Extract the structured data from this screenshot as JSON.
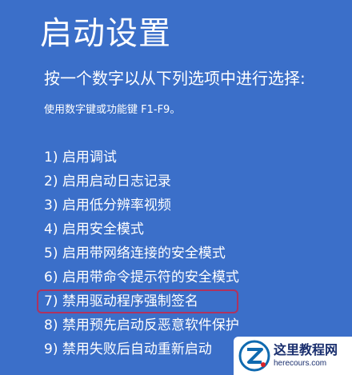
{
  "title": "启动设置",
  "subtitle": "按一个数字以从下列选项中进行选择:",
  "hint": "使用数字键或功能键 F1-F9。",
  "options": [
    {
      "number": "1)",
      "label": "启用调试"
    },
    {
      "number": "2)",
      "label": "启用启动日志记录"
    },
    {
      "number": "3)",
      "label": "启用低分辨率视频"
    },
    {
      "number": "4)",
      "label": "启用安全模式"
    },
    {
      "number": "5)",
      "label": "启用带网络连接的安全模式"
    },
    {
      "number": "6)",
      "label": "启用带命令提示符的安全模式"
    },
    {
      "number": "7)",
      "label": "禁用驱动程序强制签名"
    },
    {
      "number": "8)",
      "label": "禁用预先启动反恶意软件保护"
    },
    {
      "number": "9)",
      "label": "禁用失败后自动重新启动"
    }
  ],
  "highlighted_option": 7,
  "watermark": {
    "title": "这里教程网",
    "url": "herecours.com",
    "logo_icon": "z-logo-icon"
  },
  "colors": {
    "background": "#3b6fc9",
    "text": "#ffffff",
    "highlight_border": "#b0325e",
    "watermark_text": "#1a2f6e",
    "watermark_logo": "#0f6ab0"
  }
}
